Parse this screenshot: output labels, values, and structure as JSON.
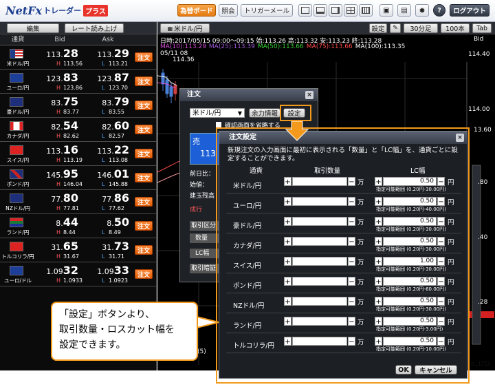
{
  "header": {
    "logo_main": "NetFx",
    "logo_sub": "トレーダー",
    "logo_plus": "プラス",
    "buttons": {
      "rates": "為替ボード",
      "inquiry": "照会",
      "trigger_mail": "トリガーメール",
      "logout": "ログアウト"
    },
    "help": "?"
  },
  "rate_panel": {
    "toolbar": {
      "edit": "編集",
      "read_rate": "レート読み上げ"
    },
    "columns": {
      "currency": "通貨",
      "bid": "Bid",
      "ask": "Ask"
    },
    "order_label": "注文",
    "high_mark": "H",
    "low_mark": "L",
    "rows": [
      {
        "name": "米ドル/円",
        "bid_pre": "113.",
        "bid_big": "28",
        "ask_pre": "113.",
        "ask_big": "29",
        "high": "113.56",
        "low": "113.21",
        "flag": "us"
      },
      {
        "name": "ユーロ/円",
        "bid_pre": "123.",
        "bid_big": "83",
        "ask_pre": "123.",
        "ask_big": "87",
        "high": "123.86",
        "low": "123.70",
        "flag": "eu"
      },
      {
        "name": "豪ドル/円",
        "bid_pre": "83.",
        "bid_big": "75",
        "ask_pre": "83.",
        "ask_big": "79",
        "high": "83.77",
        "low": "83.55",
        "flag": "au"
      },
      {
        "name": "カナダ/円",
        "bid_pre": "82.",
        "bid_big": "54",
        "ask_pre": "82.",
        "ask_big": "60",
        "high": "82.62",
        "low": "82.57",
        "flag": "ca"
      },
      {
        "name": "スイス/円",
        "bid_pre": "113.",
        "bid_big": "16",
        "ask_pre": "113.",
        "ask_big": "22",
        "high": "113.19",
        "low": "113.08",
        "flag": "ch"
      },
      {
        "name": "ポンド/円",
        "bid_pre": "145.",
        "bid_big": "95",
        "ask_pre": "146.",
        "ask_big": "01",
        "high": "146.04",
        "low": "145.88",
        "flag": "gb"
      },
      {
        "name": "NZドル/円",
        "bid_pre": "77.",
        "bid_big": "80",
        "ask_pre": "77.",
        "ask_big": "86",
        "high": "77.81",
        "low": "77.62",
        "flag": "nz"
      },
      {
        "name": "ランド/円",
        "bid_pre": "8.",
        "bid_big": "44",
        "ask_pre": "8.",
        "ask_big": "50",
        "high": "8.44",
        "low": "8.49",
        "flag": "za"
      },
      {
        "name": "トルコリラ/円",
        "bid_pre": "31.",
        "bid_big": "65",
        "ask_pre": "31.",
        "ask_big": "73",
        "high": "31.67",
        "low": "31.71",
        "flag": "tr"
      },
      {
        "name": "ユーロ/ドル",
        "bid_pre": "1.09",
        "bid_big": "32",
        "ask_pre": "1.09",
        "ask_big": "33",
        "high": "1.0933",
        "low": "1.0923",
        "flag": "eu"
      }
    ]
  },
  "chart": {
    "pair_tab": "米ドル/円",
    "buttons": {
      "settings": "設定",
      "timeframe": "30分足",
      "count": "100本",
      "tab": "Tab"
    },
    "bid_label": "Bid",
    "info_line1": "日時:2017/05/15 09:00～09:15 始:113.26 高:113.32 安:113.23 終:113.28",
    "ma_items": [
      {
        "text": "MA(10):113.29",
        "color": "#d24bd2"
      },
      {
        "text": "MA(25):113.39",
        "color": "#a05ad8"
      },
      {
        "text": "MA(50):113.66",
        "color": "#3ad23a"
      },
      {
        "text": "MA(75):113.66",
        "color": "#ff4b4b"
      },
      {
        "text": "MA(100):113.35",
        "color": "#ffffff"
      }
    ],
    "marker_date": "05/11 08",
    "marker_value": "114.36",
    "y_labels": [
      "114.40",
      "114.00",
      "13.60",
      ".80",
      ".40",
      ".28"
    ],
    "partial_b1": "(5)",
    "footer": "o.,LTD."
  },
  "order_dialog": {
    "title": "注文",
    "pair_select": "米ドル/円",
    "margin_button": "余力情報",
    "settings_button": "設定",
    "confirm_label": "確認画面を省略する",
    "sell_label": "売",
    "sell_price": "113",
    "labels": [
      "前日比：",
      "始値：",
      "建玉残高",
      "成行",
      "取引区分",
      "数量",
      "LC幅",
      "取引暗証"
    ]
  },
  "settings_dialog": {
    "title": "注文設定",
    "description": "新規注文の入力画面に最初に表示される「数量」と「LC幅」を、通貨ごとに設定することができます。",
    "col_currency": "通貨",
    "col_quantity": "取引数量",
    "col_lc": "LC幅",
    "unit_man": "万",
    "unit_yen": "円",
    "plus": "+",
    "minus": "−",
    "ok": "OK",
    "cancel": "キャンセル",
    "rows": [
      {
        "name": "米ドル/円",
        "qty": "",
        "lc": "0.50",
        "range": "指定可能範囲 (0.20円-30.00円)"
      },
      {
        "name": "ユーロ/円",
        "qty": "",
        "lc": "0.50",
        "range": "指定可能範囲 (0.20円-40.00円)"
      },
      {
        "name": "豪ドル/円",
        "qty": "",
        "lc": "0.50",
        "range": "指定可能範囲 (0.20円-30.00円)"
      },
      {
        "name": "カナダ/円",
        "qty": "",
        "lc": "0.50",
        "range": "指定可能範囲 (0.20円-30.00円)"
      },
      {
        "name": "スイス/円",
        "qty": "",
        "lc": "1.00",
        "range": "指定可能範囲 (0.20円-30.00円)"
      },
      {
        "name": "ポンド/円",
        "qty": "",
        "lc": "0.50",
        "range": "指定可能範囲 (0.20円-60.00円)"
      },
      {
        "name": "NZドル/円",
        "qty": "",
        "lc": "0.50",
        "range": "指定可能範囲 (0.20円-30.00円)"
      },
      {
        "name": "ランド/円",
        "qty": "",
        "lc": "0.50",
        "range": "指定可能範囲 (0.20円-3.00円)"
      },
      {
        "name": "トルコリラ/円",
        "qty": "",
        "lc": "0.50",
        "range": "指定可能範囲 (0.20円-10.00円)"
      }
    ]
  },
  "callout": {
    "line1": "「設定」ボタンより、",
    "line2": "取引数量・ロスカット幅を",
    "line3": "設定できます。"
  },
  "colors": {
    "accent_orange": "#f39a1d",
    "order_orange": "#e35a00",
    "high_red": "#ff5a5a",
    "low_blue": "#4aa6ff"
  }
}
